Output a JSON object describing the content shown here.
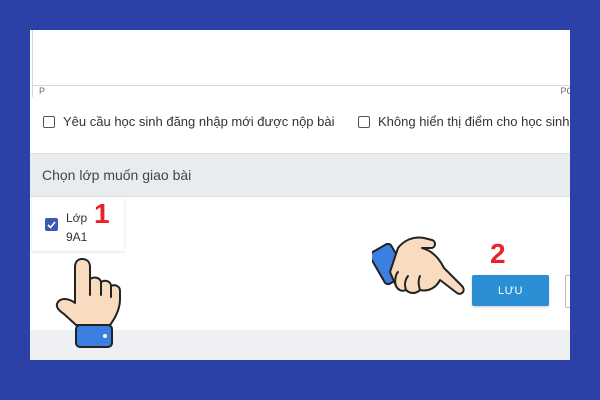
{
  "editor": {
    "status_left": "P",
    "status_right": "PC"
  },
  "options": {
    "require_login_label": "Yêu cầu học sinh đăng nhập mới được nộp bài",
    "hide_score_label": "Không hiển thị điểm cho học sinh"
  },
  "class_section": {
    "header": "Chọn lớp muốn giao bài",
    "class_label": "Lớp 9A1",
    "class_checked": true
  },
  "actions": {
    "save_label": "LƯU"
  },
  "annotations": {
    "step1": "1",
    "step2": "2"
  },
  "colors": {
    "background": "#2c41a8",
    "save_button": "#2a8fd4",
    "step_numbers": "#e8222a",
    "checkbox_checked": "#3a5ab5"
  },
  "icons": {
    "pointer_hand_1": "pointing-hand-icon",
    "pointer_hand_2": "pointing-hand-icon"
  }
}
